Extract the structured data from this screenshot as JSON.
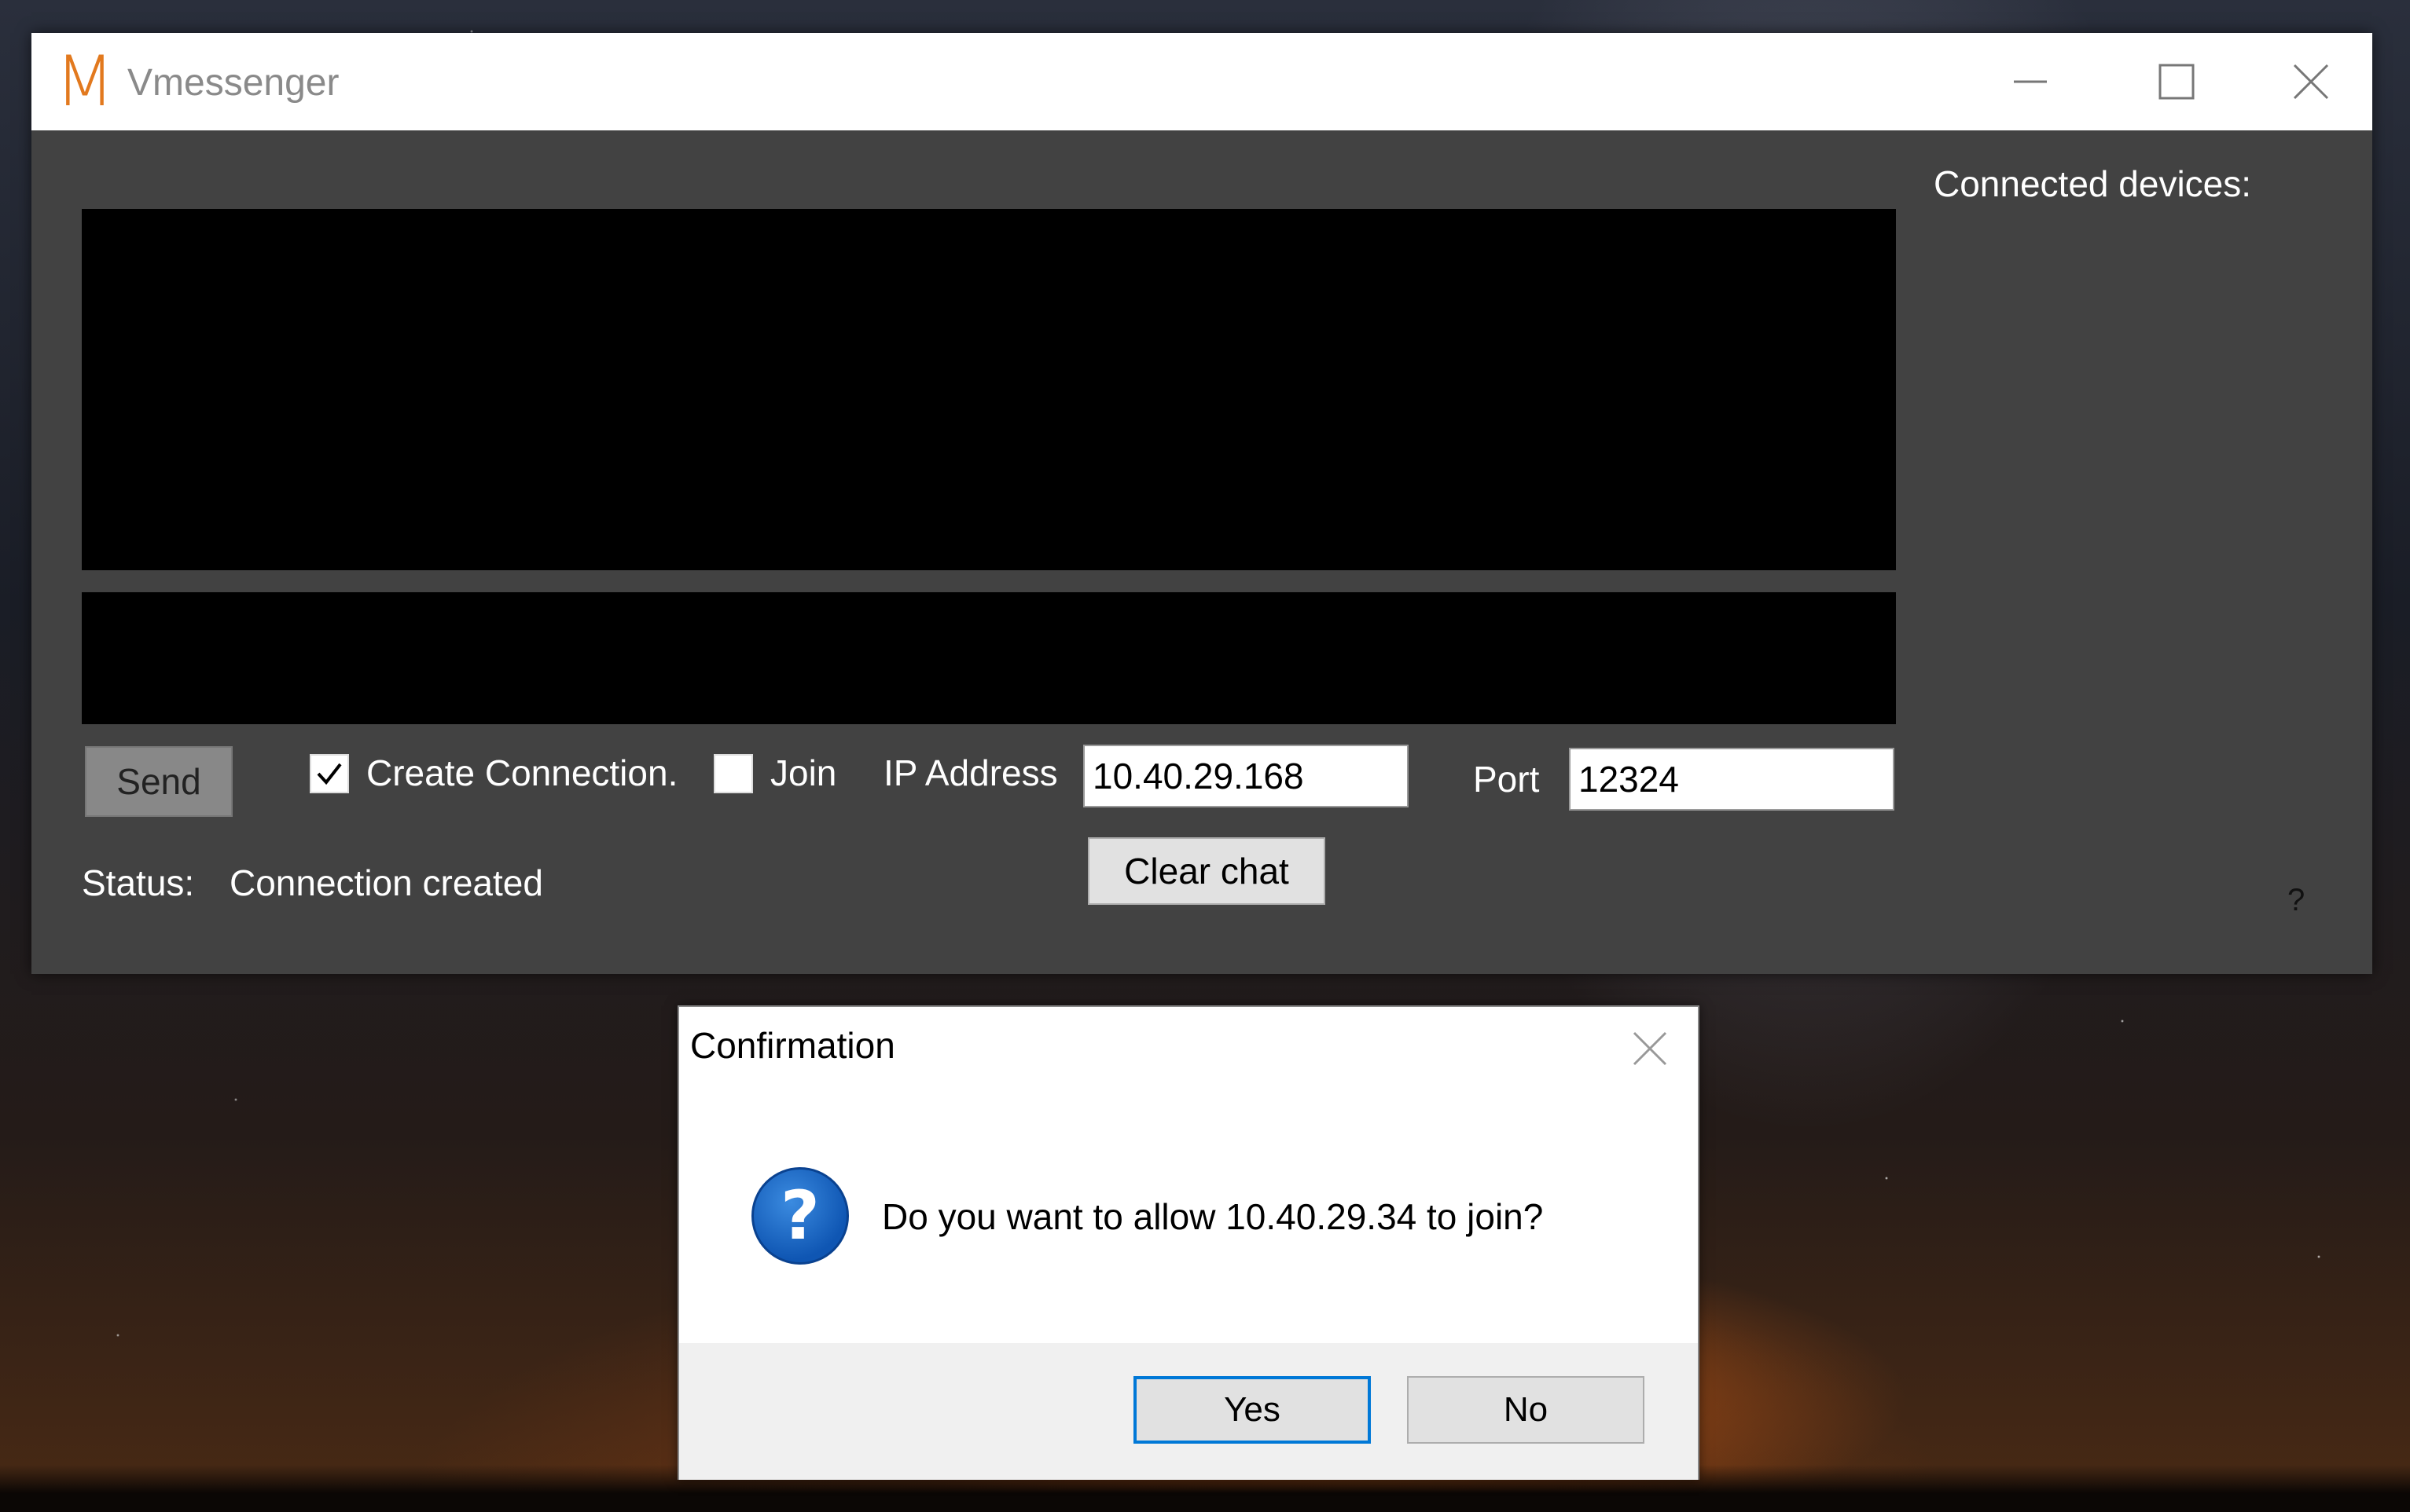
{
  "window": {
    "logo_letter": "M",
    "title": "Vmessenger",
    "controls": {
      "minimize": "minimize-icon",
      "maximize": "maximize-icon",
      "close": "close-icon"
    }
  },
  "sidebar": {
    "connected_label": "Connected devices:"
  },
  "chat": {
    "messages": "",
    "input_value": ""
  },
  "controls": {
    "send_label": "Send",
    "create_connection_label": "Create Connection.",
    "create_connection_checked": true,
    "join_label": "Join",
    "join_checked": false,
    "ip_label": "IP Address",
    "ip_value": "10.40.29.168",
    "port_label": "Port",
    "port_value": "12324",
    "clear_chat_label": "Clear chat"
  },
  "status": {
    "label": "Status:",
    "value": "Connection created"
  },
  "help": {
    "label": "?"
  },
  "dialog": {
    "title": "Confirmation",
    "icon": "question-icon",
    "message": "Do you want to allow 10.40.29.34  to join?",
    "yes_label": "Yes",
    "no_label": "No"
  },
  "colors": {
    "window_bg": "#424242",
    "chat_bg": "#000000",
    "logo": "#e2791e",
    "focus": "#0078d7"
  }
}
